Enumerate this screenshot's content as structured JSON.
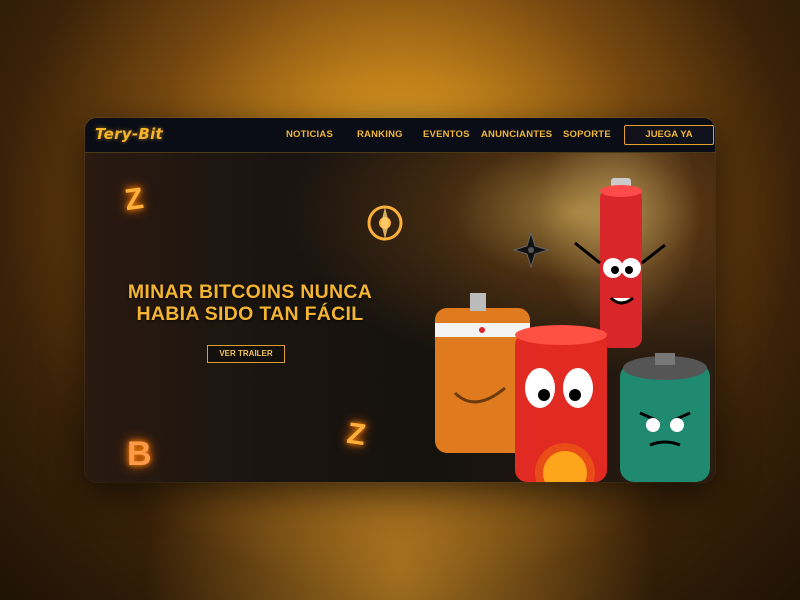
{
  "brand": {
    "logo": "Tery-Bit"
  },
  "nav": {
    "items": [
      {
        "label": "NOTICIAS"
      },
      {
        "label": "RANKING"
      },
      {
        "label": "EVENTOS"
      },
      {
        "label": "ANUNCIANTES"
      },
      {
        "label": "SOPORTE"
      }
    ],
    "cta_label": "JUEGA YA"
  },
  "hero": {
    "title_line1": "MINAR BITCOINS NUNCA",
    "title_line2": "HABIA SIDO TAN FÁCIL",
    "trailer_label": "VER TRAILER"
  },
  "icons": {
    "coin_z": "Z",
    "coin_b": "B"
  },
  "colors": {
    "accent": "#f3b433",
    "nav_bg": "#0a0d16",
    "battery_red": "#d8262a",
    "battery_orange": "#e07a1e",
    "battery_green": "#1f8a70"
  }
}
